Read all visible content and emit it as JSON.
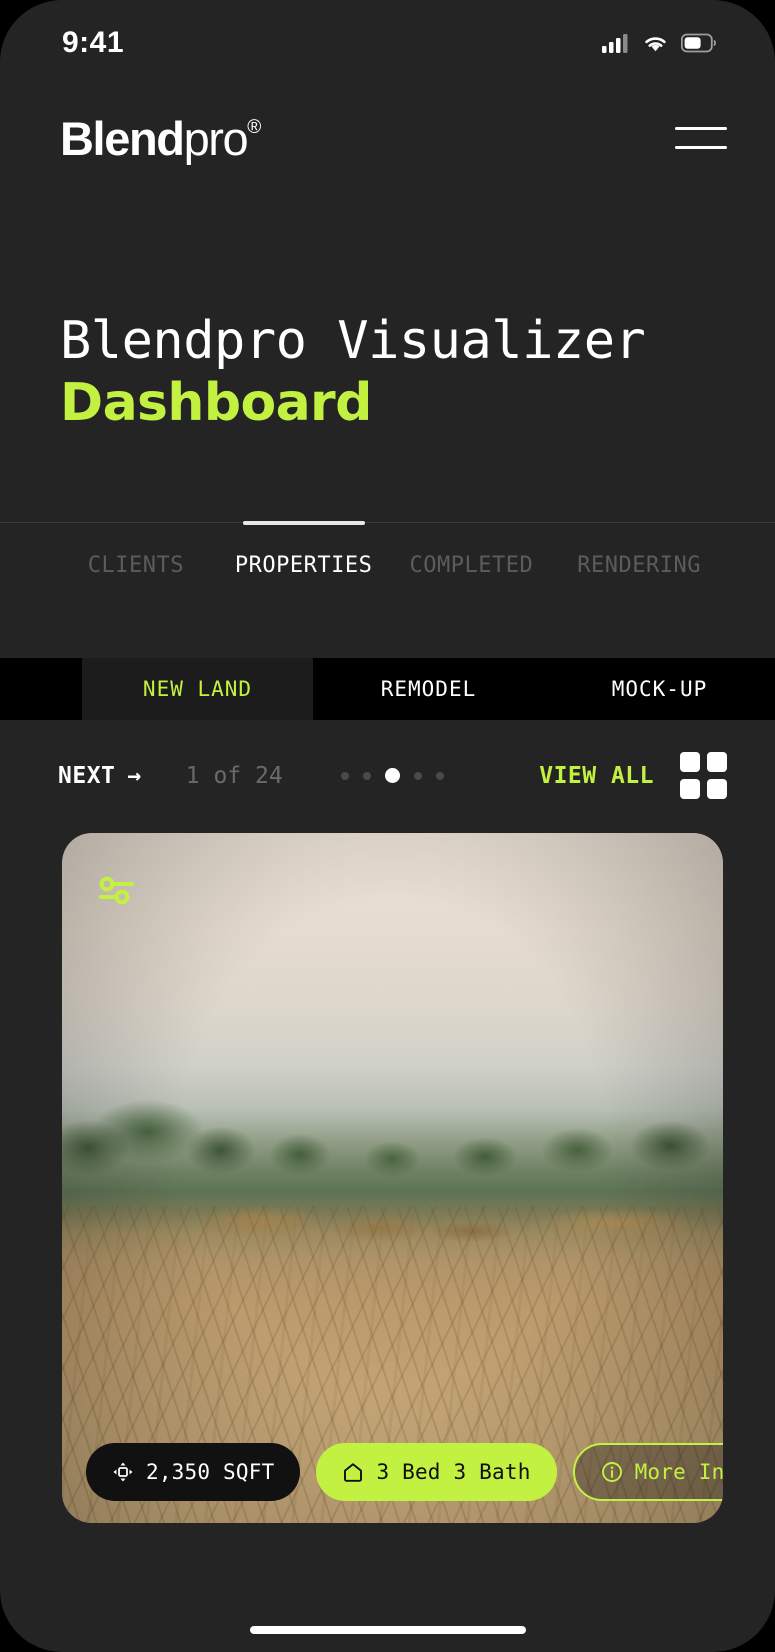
{
  "status_bar": {
    "time": "9:41",
    "cellular_icon": "cellular-signal-icon",
    "wifi_icon": "wifi-icon",
    "battery_icon": "battery-icon"
  },
  "top_bar": {
    "logo_bold": "Blend",
    "logo_light": "pro",
    "logo_registered": "®",
    "menu_icon": "hamburger-menu-icon"
  },
  "hero": {
    "title_line1": "Blendpro Visualizer",
    "title_line2": "Dashboard",
    "accent_color": "#c3f141"
  },
  "primary_tabs": {
    "active_index": 1,
    "items": [
      {
        "label": "CLIENTS"
      },
      {
        "label": "PROPERTIES"
      },
      {
        "label": "COMPLETED"
      },
      {
        "label": "RENDERING"
      }
    ]
  },
  "secondary_tabs": {
    "active_index": 0,
    "items": [
      {
        "label": "NEW LAND"
      },
      {
        "label": "REMODEL"
      },
      {
        "label": "MOCK-UP"
      }
    ]
  },
  "carousel_nav": {
    "next_label": "NEXT",
    "next_arrow": "→",
    "counter": "1 of 24",
    "dot_count": 5,
    "active_dot": 2,
    "view_all_label": "VIEW ALL",
    "grid_icon": "grid-view-icon"
  },
  "property_card": {
    "settings_icon": "sliders-settings-icon",
    "pills": [
      {
        "icon": "resize-area-icon",
        "label": "2,350 SQFT",
        "style": "dark"
      },
      {
        "icon": "home-icon",
        "label": "3 Bed 3 Bath",
        "style": "lime"
      },
      {
        "icon": "info-icon",
        "label": "More Info",
        "style": "ghost"
      }
    ]
  }
}
